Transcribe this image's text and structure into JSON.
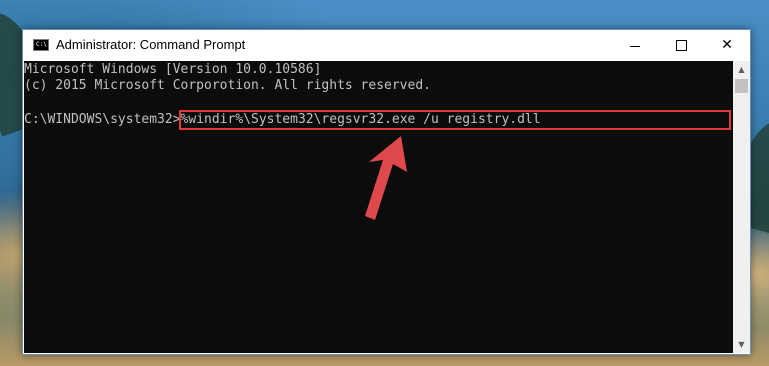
{
  "window": {
    "title": "Administrator: Command Prompt",
    "icon": "command-prompt-icon",
    "icon_text": "C:\\"
  },
  "controls": {
    "minimize": "minimize-icon",
    "maximize": "maximize-icon",
    "close_glyph": "✕"
  },
  "console": {
    "lines": [
      "Microsoft Windows [Version 10.0.10586]",
      "(c) 2015 Microsoft Corporotion. All rights reserved."
    ],
    "prompt": "C:\\WINDOWS\\system32>",
    "command": "%windir%\\System32\\regsvr32.exe /u registry.dll"
  },
  "annotation": {
    "highlight_color": "#e0393b",
    "arrow_color": "#e0494b"
  },
  "scrollbar": {
    "up_glyph": "▲",
    "down_glyph": "▼"
  }
}
